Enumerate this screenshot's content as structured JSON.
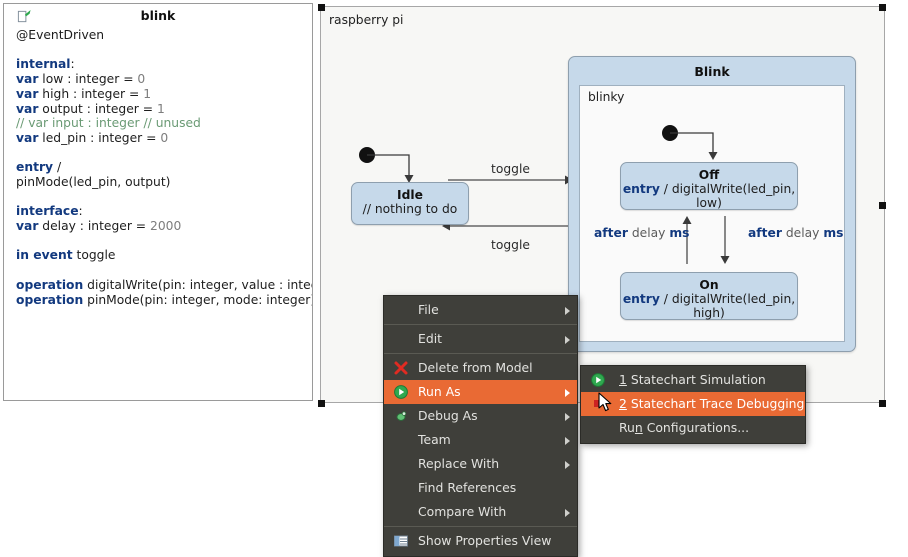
{
  "editor": {
    "title": "blink",
    "icon": "statechart-document-icon",
    "lines": [
      {
        "t": "annotation",
        "text": "@EventDriven"
      },
      {
        "t": "blank"
      },
      {
        "t": "kwline",
        "kw": "internal",
        "rest": ":"
      },
      {
        "t": "var",
        "kw": "var",
        "name": " low : integer = ",
        "num": "0"
      },
      {
        "t": "var",
        "kw": "var",
        "name": " high : integer = ",
        "num": "1"
      },
      {
        "t": "var",
        "kw": "var",
        "name": " output : integer = ",
        "num": "1"
      },
      {
        "t": "comment",
        "text": "// var input : integer // unused"
      },
      {
        "t": "var",
        "kw": "var",
        "name": " led_pin : integer = ",
        "num": "0"
      },
      {
        "t": "blank"
      },
      {
        "t": "kwline",
        "kw": "entry",
        "rest": " /"
      },
      {
        "t": "plain",
        "text": "pinMode(led_pin, output)"
      },
      {
        "t": "blank"
      },
      {
        "t": "kwline",
        "kw": "interface",
        "rest": ":"
      },
      {
        "t": "var",
        "kw": "var",
        "name": " delay : integer = ",
        "num": "2000"
      },
      {
        "t": "blank"
      },
      {
        "t": "kwline",
        "kw": "in event",
        "rest": " toggle"
      },
      {
        "t": "blank"
      },
      {
        "t": "kwline",
        "kw": "operation",
        "rest": " digitalWrite(pin: integer, value : integer)"
      },
      {
        "t": "kwline",
        "kw": "operation",
        "rest": " pinMode(pin: integer, mode: integer)"
      }
    ]
  },
  "diagram": {
    "region_name": "raspberry pi",
    "idle_state": {
      "name": "Idle",
      "body": "// nothing to do"
    },
    "transitions": {
      "to_blink": "toggle",
      "to_idle": "toggle",
      "off_to_on": {
        "kw1": "after",
        "mid": " delay ",
        "kw2": "ms"
      },
      "on_to_off": {
        "kw1": "after",
        "mid": " delay ",
        "kw2": "ms"
      }
    },
    "blink_state": {
      "name": "Blink",
      "region_name": "blinky",
      "off_state": {
        "name": "Off",
        "kw": "entry",
        "body": " / digitalWrite(led_pin, low)"
      },
      "on_state": {
        "name": "On",
        "kw": "entry",
        "body": " / digitalWrite(led_pin, high)"
      }
    }
  },
  "context_menu": {
    "items": [
      {
        "label": "File",
        "submenu": true,
        "icon": null,
        "selected": false
      },
      {
        "sep": true
      },
      {
        "label": "Edit",
        "submenu": true,
        "icon": null,
        "selected": false
      },
      {
        "sep": true
      },
      {
        "label": "Delete from Model",
        "submenu": false,
        "icon": "delete-x-icon",
        "selected": false
      },
      {
        "label": "Run As",
        "submenu": true,
        "icon": "run-play-icon",
        "selected": true
      },
      {
        "label": "Debug As",
        "submenu": true,
        "icon": "debug-bug-icon",
        "selected": false
      },
      {
        "label": "Team",
        "submenu": true,
        "icon": null,
        "selected": false
      },
      {
        "label": "Replace With",
        "submenu": true,
        "icon": null,
        "selected": false
      },
      {
        "label": "Find References",
        "submenu": false,
        "icon": null,
        "selected": false
      },
      {
        "label": "Compare With",
        "submenu": true,
        "icon": null,
        "selected": false
      },
      {
        "sep": true
      },
      {
        "label": "Show Properties View",
        "submenu": false,
        "icon": "properties-view-icon",
        "selected": false
      }
    ]
  },
  "submenu": {
    "items": [
      {
        "mnemonic": "1",
        "label": " Statechart Simulation",
        "icon": "run-play-icon",
        "selected": false
      },
      {
        "mnemonic": "2",
        "label": " Statechart Trace Debugging",
        "icon": "trace-stop-icon",
        "selected": true
      },
      {
        "pre": "Ru",
        "mnemonic": "n",
        "label": " Configurations...",
        "icon": null,
        "selected": false
      }
    ]
  },
  "colors": {
    "menu_bg": "#3f3f3a",
    "menu_highlight": "#e96a34",
    "state_fill": "#c6d9ea",
    "keyword": "#12397f",
    "comment": "#6a9a74"
  }
}
